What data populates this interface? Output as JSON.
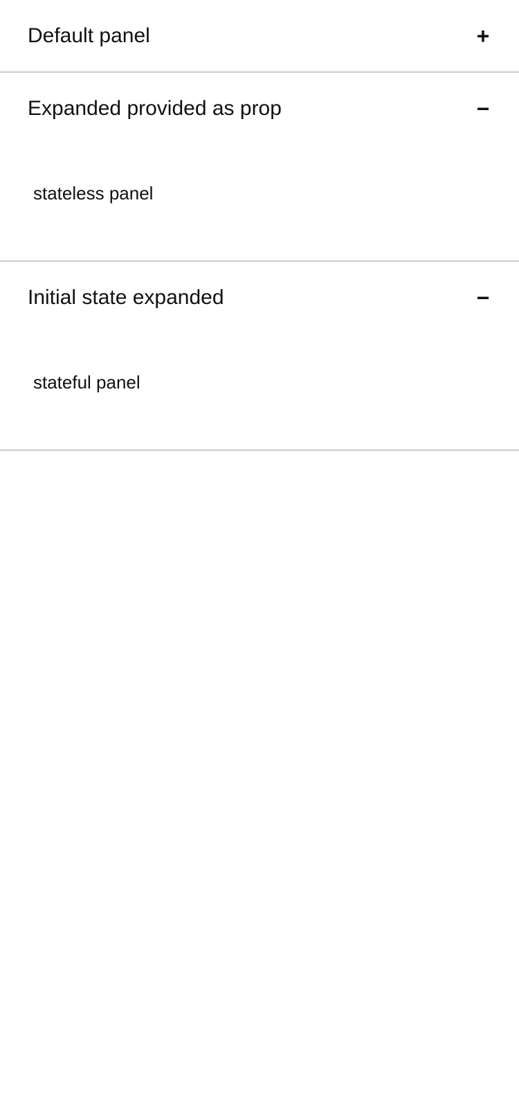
{
  "panels": [
    {
      "title": "Default panel",
      "toggle_symbol": "+",
      "toggle_icon": "plus-icon",
      "expanded": false,
      "content": ""
    },
    {
      "title": "Expanded provided as prop",
      "toggle_symbol": "−",
      "toggle_icon": "minus-icon",
      "expanded": true,
      "content": "stateless panel"
    },
    {
      "title": "Initial state expanded",
      "toggle_symbol": "−",
      "toggle_icon": "minus-icon",
      "expanded": true,
      "content": "stateful panel"
    }
  ],
  "colors": {
    "text": "#111111",
    "divider": "#cccccc",
    "background": "#ffffff"
  }
}
